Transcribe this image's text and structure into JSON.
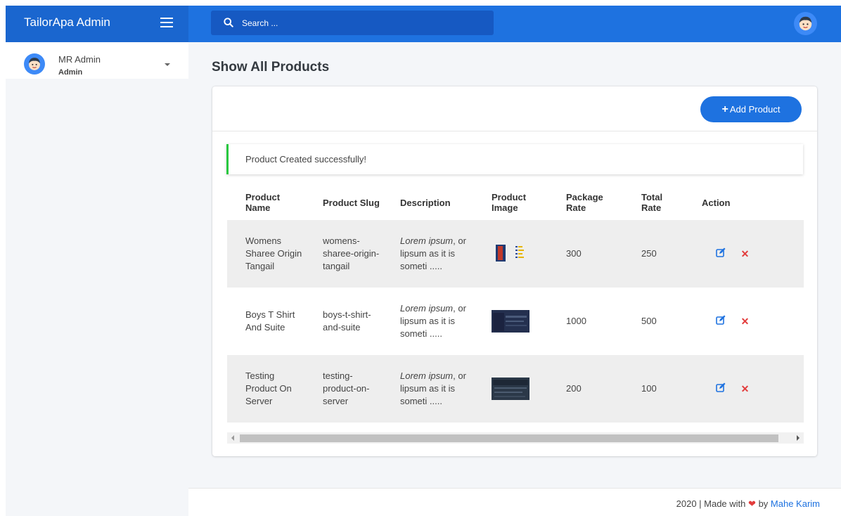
{
  "header": {
    "brand": "TailorApa Admin",
    "search_placeholder": "Search ..."
  },
  "sidebar": {
    "user_name": "MR Admin",
    "user_role": "Admin"
  },
  "main": {
    "page_title": "Show All Products",
    "add_button_label": "Add Product",
    "alert_text": "Product Created successfully!",
    "columns": [
      "Product Name",
      "Product Slug",
      "Description",
      "Product Image",
      "Package Rate",
      "Total Rate",
      "Action"
    ],
    "rows": [
      {
        "name": "Womens Sharee Origin Tangail",
        "slug": "womens-sharee-origin-tangail",
        "desc_italic": "Lorem ipsum",
        "desc_rest": ", or lipsum as it is someti .....",
        "package_rate": "300",
        "total_rate": "250"
      },
      {
        "name": "Boys T Shirt And Suite",
        "slug": "boys-t-shirt-and-suite",
        "desc_italic": "Lorem ipsum",
        "desc_rest": ", or lipsum as it is someti .....",
        "package_rate": "1000",
        "total_rate": "500"
      },
      {
        "name": "Testing Product On Server",
        "slug": "testing-product-on-server",
        "desc_italic": "Lorem ipsum",
        "desc_rest": ", or lipsum as it is someti .....",
        "package_rate": "200",
        "total_rate": "100"
      }
    ]
  },
  "footer": {
    "prefix": "2020 | Made with",
    "by": "by",
    "author": "Mahe Karim"
  },
  "colors": {
    "primary": "#1e72e0",
    "danger": "#e23b3b",
    "success": "#28c840"
  },
  "icons": [
    "menu-icon",
    "search-icon",
    "avatar-icon",
    "caret-down-icon",
    "plus-icon",
    "edit-icon",
    "delete-icon",
    "heart-icon"
  ]
}
